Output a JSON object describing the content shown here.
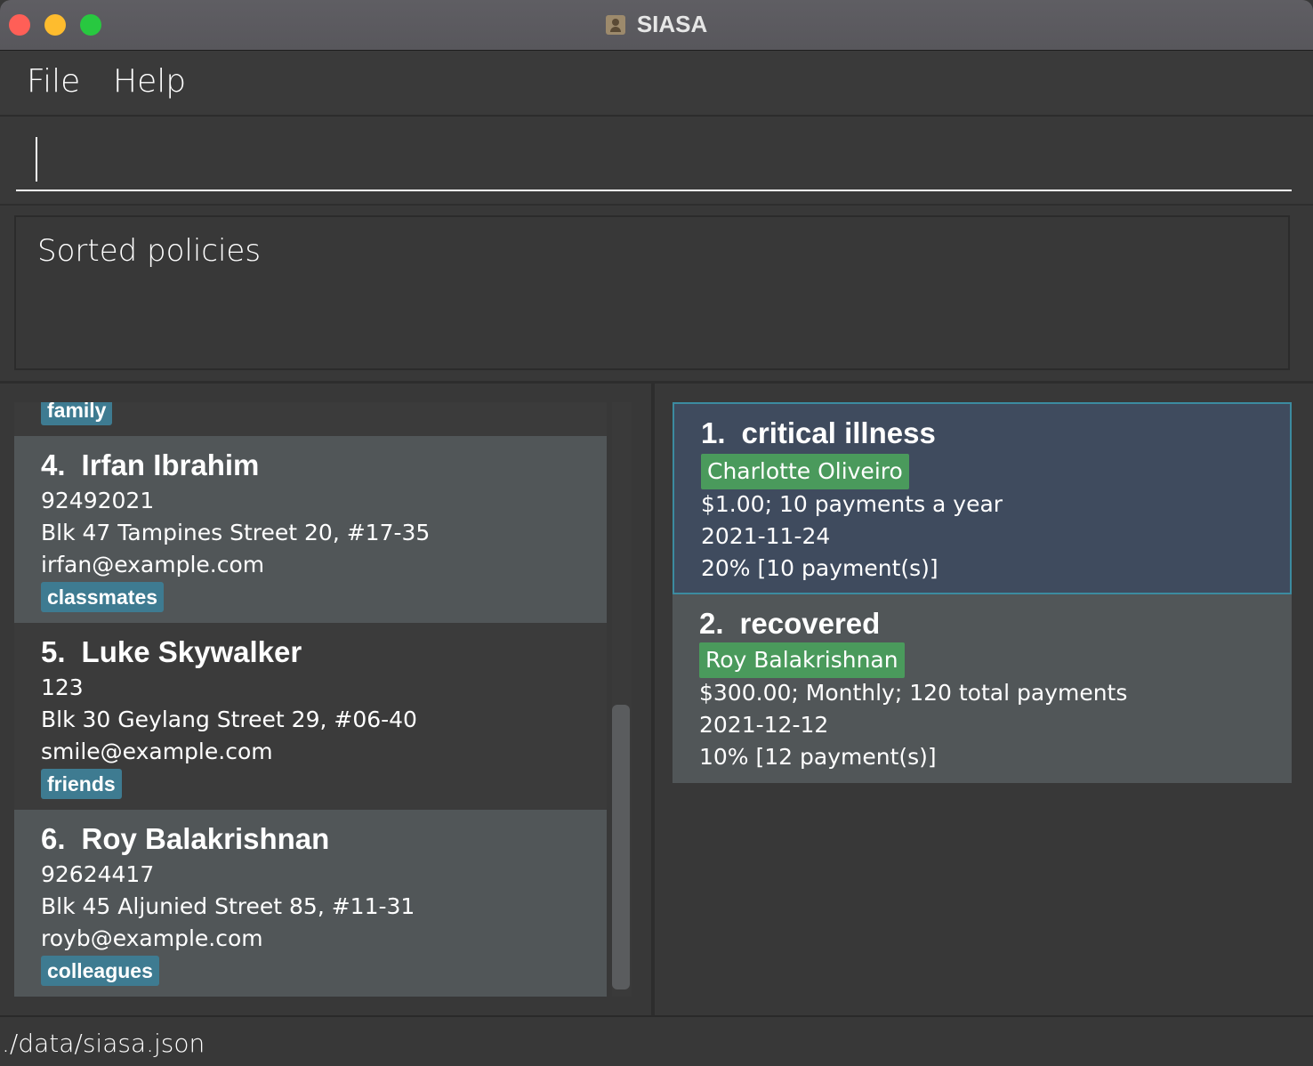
{
  "window": {
    "title": "SIASA",
    "icon": "addressbook-icon"
  },
  "menu": {
    "file": "File",
    "help": "Help"
  },
  "command": {
    "value": "",
    "placeholder": ""
  },
  "result": {
    "text": "Sorted policies"
  },
  "persons": {
    "partial_tag": "family",
    "items": [
      {
        "index": "4.",
        "name": "Irfan Ibrahim",
        "phone": "92492021",
        "address": "Blk 47 Tampines Street 20, #17-35",
        "email": "irfan@example.com",
        "tag": "classmates"
      },
      {
        "index": "5.",
        "name": "Luke Skywalker",
        "phone": "123",
        "address": "Blk 30 Geylang Street 29, #06-40",
        "email": "smile@example.com",
        "tag": "friends"
      },
      {
        "index": "6.",
        "name": "Roy Balakrishnan",
        "phone": "92624417",
        "address": "Blk 45 Aljunied Street 85, #11-31",
        "email": "royb@example.com",
        "tag": "colleagues"
      }
    ]
  },
  "policies": {
    "items": [
      {
        "index": "1.",
        "title": "critical illness",
        "owner": "Charlotte Oliveiro",
        "payment": "$1.00; 10 payments a year",
        "expiry": "2021-11-24",
        "commission": "20% [10 payment(s)]",
        "selected": true
      },
      {
        "index": "2.",
        "title": "recovered",
        "owner": "Roy Balakrishnan",
        "payment": "$300.00; Monthly; 120 total payments",
        "expiry": "2021-12-12",
        "commission": "10% [12 payment(s)]",
        "selected": false
      }
    ]
  },
  "status": {
    "path": "./data/siasa.json"
  },
  "colors": {
    "tag": "#3e7b91",
    "owner_label": "#4a9a5c",
    "selected_card": "#3f4b5e",
    "selected_border": "#3c8ba0"
  }
}
